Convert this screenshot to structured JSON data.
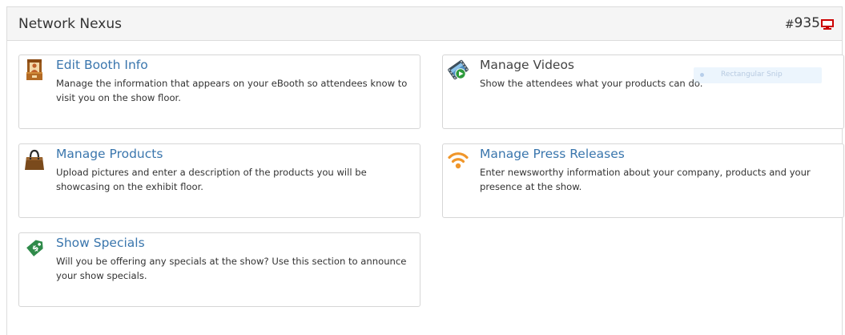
{
  "header": {
    "title": "Network Nexus",
    "booth_hash": "#",
    "booth_number": "935"
  },
  "cards": [
    {
      "title": "Edit Booth Info",
      "description": "Manage the information that appears on your eBooth so attendees know to visit you on the show floor.",
      "icon": "booth-icon"
    },
    {
      "title": "Manage Videos",
      "description": "Show the attendees what your products can do.",
      "icon": "video-icon"
    },
    {
      "title": "Manage Products",
      "description": "Upload pictures and enter a description of the products you will be showcasing on the exhibit floor.",
      "icon": "shopping-bag-icon"
    },
    {
      "title": "Manage Press Releases",
      "description": "Enter newsworthy information about your company, products and your presence at the show.",
      "icon": "rss-icon"
    },
    {
      "title": "Show Specials",
      "description": "Will you be offering any specials at the show? Use this section to announce your show specials.",
      "icon": "price-tag-icon"
    }
  ],
  "overlay": {
    "text": "Rectangular Snip"
  },
  "colors": {
    "link": "#3a76ad",
    "text": "#333333",
    "header_bg": "#f5f5f5",
    "border": "#d6d6d6",
    "booth_icon": "#cc0000"
  }
}
